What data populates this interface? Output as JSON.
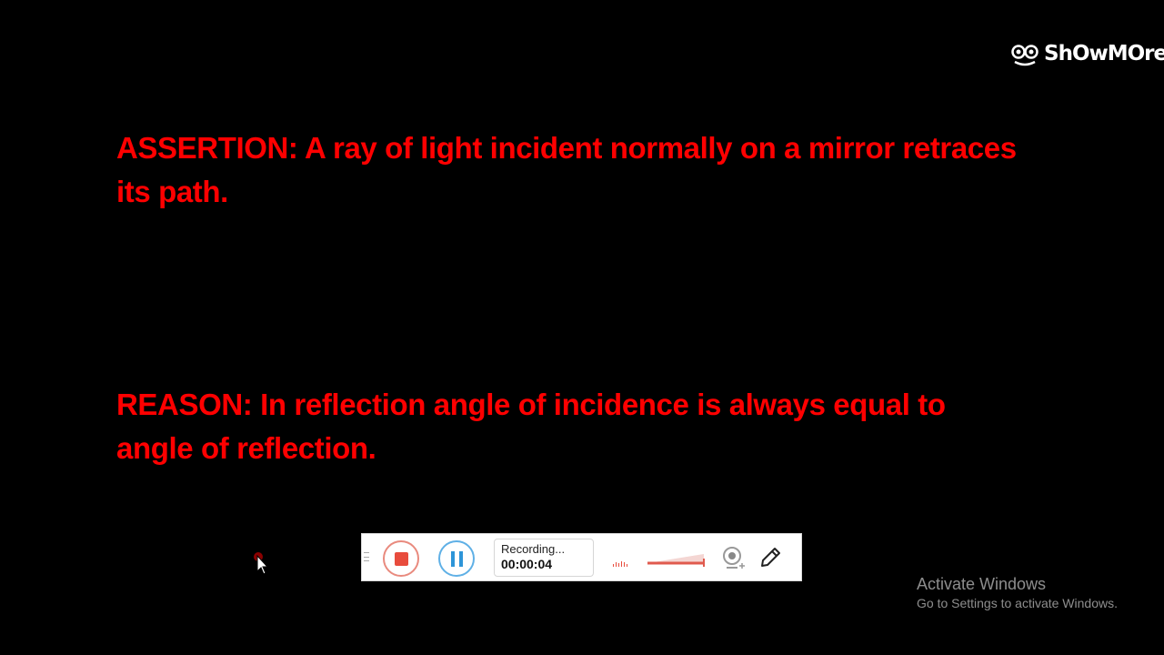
{
  "watermark": {
    "text": "ShOwMOre",
    "icon": "showmore-logo-icon"
  },
  "slide": {
    "assertion": "ASSERTION: A ray of light incident normally on a mirror retraces its path.",
    "reason": "REASON: In reflection angle of incidence is always equal to angle of reflection.",
    "text_color": "#ff0000"
  },
  "recorder": {
    "status": "Recording...",
    "elapsed": "00:00:04",
    "stop_icon": "stop-icon",
    "pause_icon": "pause-icon",
    "webcam_icon": "webcam-icon",
    "pen_icon": "pencil-icon",
    "accent_red": "#e84c3d",
    "accent_blue": "#2e95d8"
  },
  "system": {
    "activate_title": "Activate Windows",
    "activate_subtitle": "Go to Settings to activate Windows."
  }
}
